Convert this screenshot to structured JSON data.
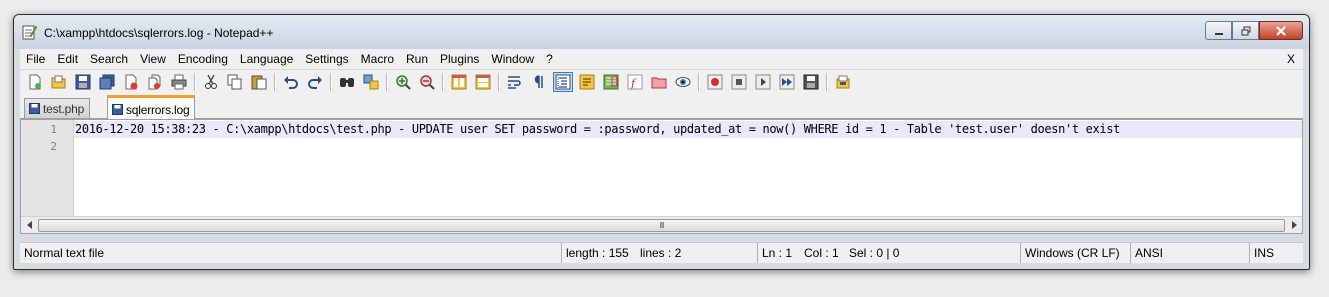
{
  "window": {
    "title": "C:\\xampp\\htdocs\\sqlerrors.log - Notepad++",
    "icon": "notepad-plus-plus-icon"
  },
  "menu": {
    "items": [
      "File",
      "Edit",
      "Search",
      "View",
      "Encoding",
      "Language",
      "Settings",
      "Macro",
      "Run",
      "Plugins",
      "Window",
      "?"
    ],
    "close_label": "X"
  },
  "toolbar": {
    "icons": [
      "new-file-icon",
      "open-file-icon",
      "save-icon",
      "save-all-icon",
      "close-icon",
      "close-all-icon",
      "print-icon",
      "cut-icon",
      "copy-icon",
      "paste-icon",
      "undo-icon",
      "redo-icon",
      "find-icon",
      "replace-icon",
      "zoom-in-icon",
      "zoom-out-icon",
      "sync-vertical-icon",
      "sync-horizontal-icon",
      "word-wrap-icon",
      "show-all-chars-icon",
      "indent-guide-icon",
      "user-language-icon",
      "document-map-icon",
      "function-list-icon",
      "folder-as-workspace-icon",
      "monitoring-icon",
      "record-macro-icon",
      "stop-macro-icon",
      "play-macro-icon",
      "run-macro-multiple-icon",
      "save-macro-icon",
      "plugin-icon"
    ],
    "active_icon": "indent-guide-icon"
  },
  "tabs": [
    {
      "label": "test.php",
      "active": false
    },
    {
      "label": "sqlerrors.log",
      "active": true
    }
  ],
  "editor": {
    "lines": [
      {
        "number": "1",
        "text": "2016-12-20 15:38:23 - C:\\xampp\\htdocs\\test.php - UPDATE user SET password = :password, updated_at = now() WHERE id = 1 - Table 'test.user' doesn't exist"
      },
      {
        "number": "2",
        "text": ""
      }
    ],
    "current_line": 1,
    "hscroll_grip": "III"
  },
  "status": {
    "file_type": "Normal text file",
    "length": "length : 155",
    "lines": "lines : 2",
    "ln": "Ln : 1",
    "col": "Col : 1",
    "sel": "Sel : 0 | 0",
    "eol": "Windows (CR LF)",
    "encoding": "ANSI",
    "mode": "INS"
  },
  "colors": {
    "active_tab_accent": "#fa9d2a",
    "current_line_bg": "#e8e8ff",
    "close_button": "#c5432a"
  }
}
